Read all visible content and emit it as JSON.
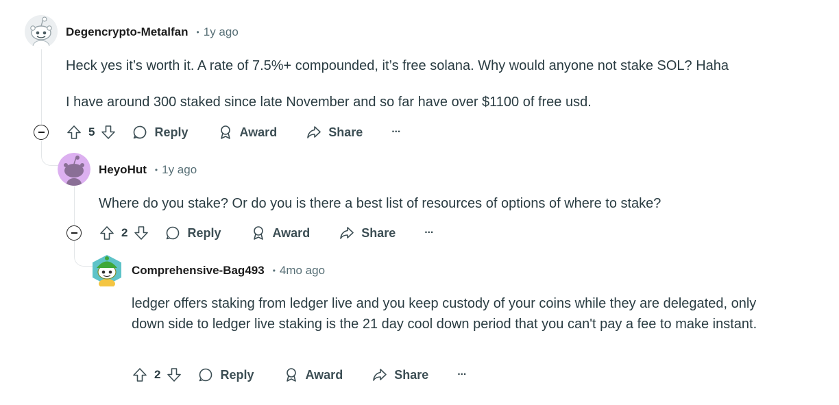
{
  "comments": [
    {
      "author": "Degencrypto-Metalfan",
      "separator": "•",
      "time": "1y ago",
      "paragraphs": [
        "Heck yes it’s worth it. A rate of 7.5%+ compounded, it’s free solana. Why would anyone not stake SOL? Haha",
        "I have around 300 staked since late November and so far have over $1100 of free usd."
      ],
      "votes": "5",
      "reply_label": "Reply",
      "award_label": "Award",
      "share_label": "Share",
      "more_label": "···",
      "avatar_icon": "reddit-snoo-grey-avatar"
    },
    {
      "author": "HeyoHut",
      "separator": "•",
      "time": "1y ago",
      "paragraphs": [
        "Where do you stake? Or do you is there a best list of resources of options of where to stake?"
      ],
      "votes": "2",
      "reply_label": "Reply",
      "award_label": "Award",
      "share_label": "Share",
      "more_label": "···",
      "avatar_icon": "reddit-snoo-purple-avatar"
    },
    {
      "author": "Comprehensive-Bag493",
      "separator": "•",
      "time": "4mo ago",
      "paragraphs": [
        "ledger offers staking from ledger live and you keep custody of your coins while they are delegated, only down side to ledger live staking is the 21 day cool down period that you can't pay a fee to make instant."
      ],
      "votes": "2",
      "reply_label": "Reply",
      "award_label": "Award",
      "share_label": "Share",
      "more_label": "···",
      "avatar_icon": "reddit-snoo-green-hat-avatar"
    }
  ],
  "colors": {
    "text": "#1c1c1c",
    "body_text": "#2a3c42",
    "meta": "#576f76",
    "thread_line": "#e3e6e8",
    "avatar_purple_bg": "#dcb0f0"
  }
}
